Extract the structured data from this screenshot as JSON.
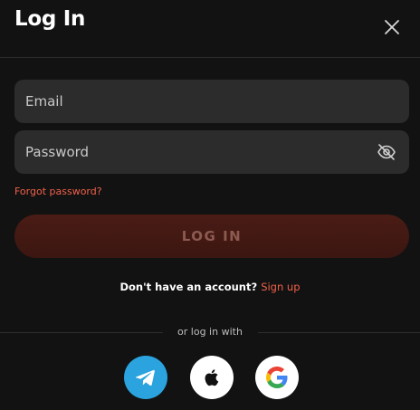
{
  "modal": {
    "title": "Log In"
  },
  "form": {
    "email_placeholder": "Email",
    "password_placeholder": "Password",
    "forgot_password_label": "Forgot password?",
    "login_button_label": "LOG IN"
  },
  "signup": {
    "prompt": "Don't have an account?",
    "link_label": "Sign up"
  },
  "social": {
    "divider_label": "or log in with",
    "providers": [
      {
        "name": "telegram",
        "icon": "telegram-icon",
        "color": "#2aa3df"
      },
      {
        "name": "apple",
        "icon": "apple-icon",
        "color": "#ffffff"
      },
      {
        "name": "google",
        "icon": "google-icon",
        "color": "#ffffff"
      }
    ]
  },
  "colors": {
    "background": "#121212",
    "field_background": "#2c2c2c",
    "accent": "#f0614a",
    "login_button": "#4a1c15"
  }
}
